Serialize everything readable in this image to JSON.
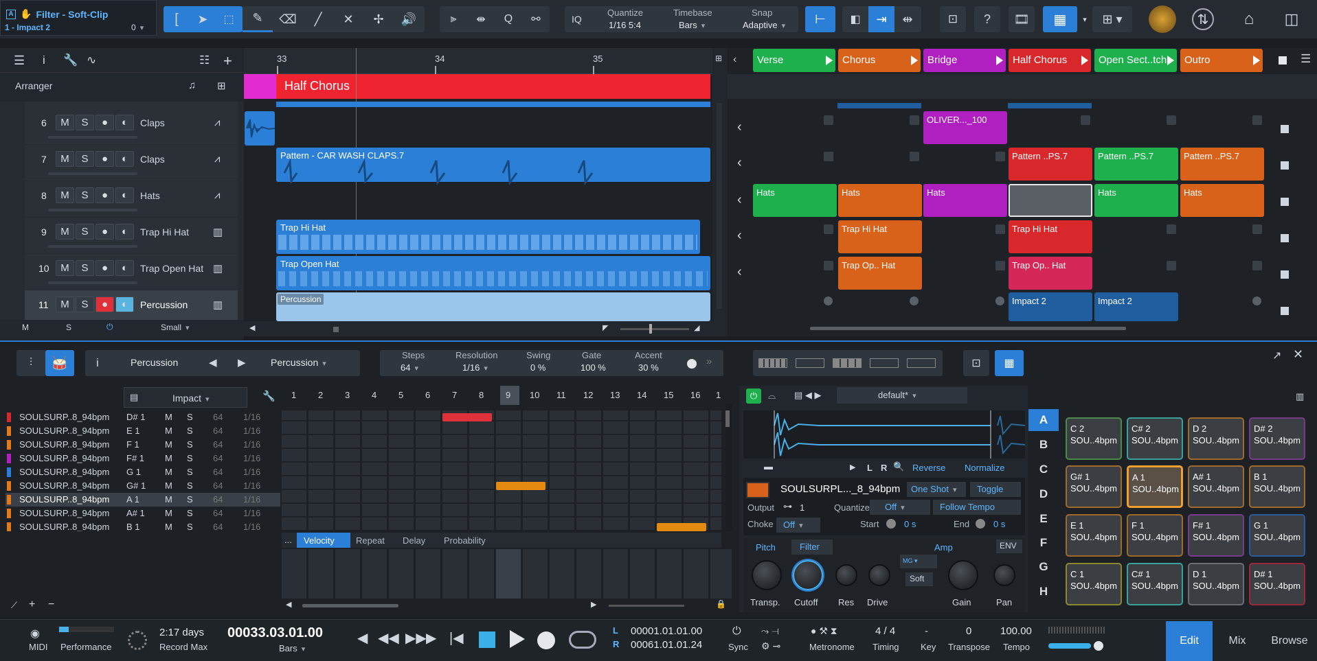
{
  "header": {
    "device": "Filter - Soft-Clip",
    "track": "1 - Impact 2",
    "count": "0",
    "quantize_label": "Quantize",
    "quantize_val": "1/16 5:4",
    "timebase_label": "Timebase",
    "timebase_val": "Bars",
    "snap_label": "Snap",
    "snap_val": "Adaptive",
    "iq": "IQ"
  },
  "arranger": {
    "label": "Arranger",
    "ruler": [
      "33",
      "34",
      "35"
    ],
    "marker": "Half Chorus",
    "tracks": [
      {
        "num": "6",
        "name": "Claps"
      },
      {
        "num": "7",
        "name": "Claps"
      },
      {
        "num": "8",
        "name": "Hats"
      },
      {
        "num": "9",
        "name": "Trap Hi Hat"
      },
      {
        "num": "10",
        "name": "Trap Open Hat"
      },
      {
        "num": "11",
        "name": "Percussion"
      }
    ],
    "clips": {
      "c7": "Pattern - CAR WASH CLAPS.7",
      "c9": "Trap Hi Hat",
      "c10": "Trap Open Hat",
      "c11": "Percussion"
    },
    "bottom": {
      "m": "M",
      "s": "S",
      "size": "Small"
    }
  },
  "launcher": {
    "scenes": [
      {
        "name": "Verse",
        "color": "#1db04c"
      },
      {
        "name": "Chorus",
        "color": "#d9621a"
      },
      {
        "name": "Bridge",
        "color": "#b01fc0"
      },
      {
        "name": "Half Chorus",
        "color": "#d9282b"
      },
      {
        "name": "Open Sect..tch",
        "color": "#1db04c"
      },
      {
        "name": "Outro",
        "color": "#d9621a"
      }
    ],
    "clips": {
      "oliver": "OLIVER..._100",
      "pat": "Pattern ..PS.7",
      "hats": "Hats",
      "thh": "Trap Hi Hat",
      "toh": "Trap Op.. Hat",
      "imp": "Impact 2"
    }
  },
  "pattern": {
    "instrument": "Percussion",
    "pattern": "Percussion",
    "steps_label": "Steps",
    "steps": "64",
    "res_label": "Resolution",
    "res": "1/16",
    "swing_label": "Swing",
    "swing": "0 %",
    "gate_label": "Gate",
    "gate": "100 %",
    "accent_label": "Accent",
    "accent": "30 %",
    "kit": "Impact",
    "step_numbers": [
      "1",
      "2",
      "3",
      "4",
      "5",
      "6",
      "7",
      "8",
      "9",
      "10",
      "11",
      "12",
      "13",
      "14",
      "15",
      "16",
      "1"
    ],
    "lanes": [
      {
        "name": "SOULSURP..8_94bpm",
        "note": "D# 1",
        "color": "#d9282b"
      },
      {
        "name": "SOULSURP..8_94bpm",
        "note": "E 1",
        "color": "#e07a1a"
      },
      {
        "name": "SOULSURP..8_94bpm",
        "note": "F 1",
        "color": "#e07a1a"
      },
      {
        "name": "SOULSURP..8_94bpm",
        "note": "F# 1",
        "color": "#b01fc0"
      },
      {
        "name": "SOULSURP..8_94bpm",
        "note": "G 1",
        "color": "#2b7fd6"
      },
      {
        "name": "SOULSURP..8_94bpm",
        "note": "G# 1",
        "color": "#e07a1a"
      },
      {
        "name": "SOULSURP..8_94bpm",
        "note": "A 1",
        "color": "#e07a1a"
      },
      {
        "name": "SOULSURP..8_94bpm",
        "note": "A# 1",
        "color": "#e07a1a"
      },
      {
        "name": "SOULSURP..8_94bpm",
        "note": "B 1",
        "color": "#e07a1a"
      }
    ],
    "lane_steps": "64",
    "lane_res": "1/16",
    "m": "M",
    "s": "S",
    "tabs": [
      "Velocity",
      "Repeat",
      "Delay",
      "Probability"
    ],
    "more": "..."
  },
  "sampler": {
    "preset": "default*",
    "reverse": "Reverse",
    "normalize": "Normalize",
    "L": "L",
    "R": "R",
    "sample": "SOULSURPL..._8_94bpm",
    "mode": "One Shot",
    "toggle": "Toggle",
    "output_label": "Output",
    "output": "1",
    "quant_label": "Quantize",
    "quant": "Off",
    "follow": "Follow Tempo",
    "choke_label": "Choke",
    "choke": "Off",
    "start_label": "Start",
    "start": "0 s",
    "end_label": "End",
    "end": "0 s",
    "pitch": "Pitch",
    "filter": "Filter",
    "amp": "Amp",
    "env": "ENV",
    "soft": "Soft",
    "mg": "MG",
    "knobs": [
      "Transp.",
      "Cutoff",
      "Res",
      "Drive",
      "Gain",
      "Pan"
    ],
    "banks": [
      "A",
      "B",
      "C",
      "D",
      "E",
      "F",
      "G",
      "H"
    ],
    "pads": [
      {
        "note": "C 2",
        "name": "SOU..4bpm",
        "color": "#4c8a4c"
      },
      {
        "note": "C# 2",
        "name": "SOU..4bpm",
        "color": "#3aa09a"
      },
      {
        "note": "D 2",
        "name": "SOU..4bpm",
        "color": "#a06a2a"
      },
      {
        "note": "D# 2",
        "name": "SOU..4bpm",
        "color": "#7a3a8a"
      },
      {
        "note": "G# 1",
        "name": "SOU..4bpm",
        "color": "#a06a2a"
      },
      {
        "note": "A 1",
        "name": "SOU..4bpm",
        "color": "#e09030"
      },
      {
        "note": "A# 1",
        "name": "SOU..4bpm",
        "color": "#a06a2a"
      },
      {
        "note": "B 1",
        "name": "SOU..4bpm",
        "color": "#a06a2a"
      },
      {
        "note": "E 1",
        "name": "SOU..4bpm",
        "color": "#a06a2a"
      },
      {
        "note": "F 1",
        "name": "SOU..4bpm",
        "color": "#a06a2a"
      },
      {
        "note": "F# 1",
        "name": "SOU..4bpm",
        "color": "#7a3a8a"
      },
      {
        "note": "G 1",
        "name": "SOU..4bpm",
        "color": "#2b5a9a"
      },
      {
        "note": "C 1",
        "name": "SOU..4bpm",
        "color": "#8a8a2a"
      },
      {
        "note": "C# 1",
        "name": "SOU..4bpm",
        "color": "#3aa09a"
      },
      {
        "note": "D 1",
        "name": "SOU..4bpm",
        "color": "#6a6e74"
      },
      {
        "note": "D# 1",
        "name": "SOU..4bpm",
        "color": "#9a2a3a"
      }
    ]
  },
  "transport": {
    "midi": "MIDI",
    "performance": "Performance",
    "record_days": "2:17 days",
    "record_max": "Record Max",
    "position": "00033.03.01.00",
    "pos_unit": "Bars",
    "L_label": "L",
    "R_label": "R",
    "loop_l": "00001.01.01.00",
    "loop_r": "00061.01.01.24",
    "sync": "Sync",
    "metronome": "Metronome",
    "timing_val": "4 / 4",
    "timing": "Timing",
    "key_val": "-",
    "key": "Key",
    "transpose_val": "0",
    "transpose": "Transpose",
    "tempo_val": "100.00",
    "tempo": "Tempo",
    "edit": "Edit",
    "mix": "Mix",
    "browse": "Browse"
  }
}
